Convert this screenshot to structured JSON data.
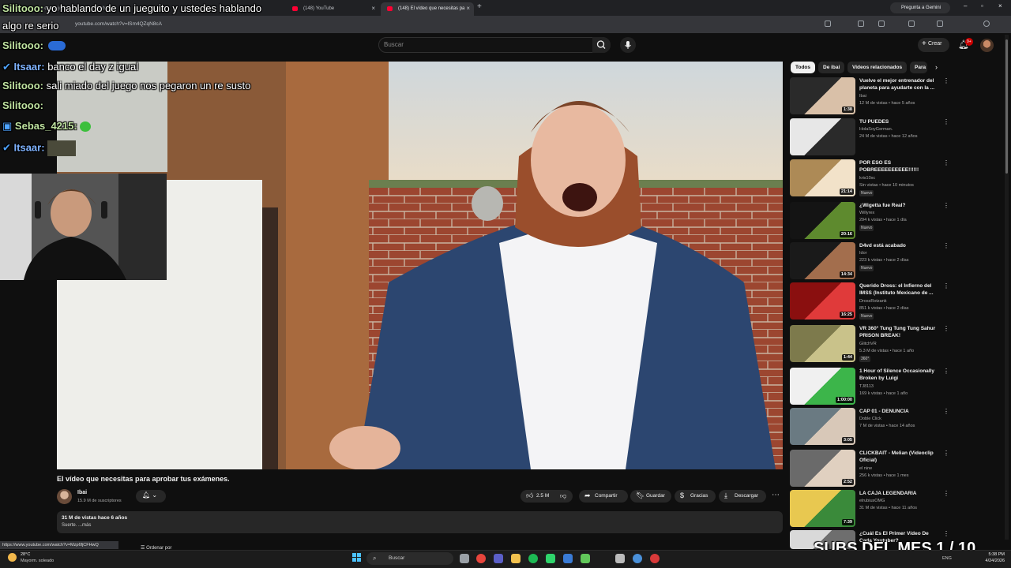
{
  "browser": {
    "tabs": [
      {
        "label": "yo hablando de un jueguito y ustedes hablando"
      },
      {
        "label": "(148) YouTube"
      },
      {
        "label": "(148) El vídeo que necesitas pa"
      }
    ],
    "url": "youtube.com/watch?v=lSm4QZqN8cA",
    "gemini_label": "Pregunta a Gemini",
    "status_url": "https://www.youtube.com/watch?v=Mzp6fjCFHwQ"
  },
  "youtube": {
    "search_placeholder": "Buscar",
    "create_label": "Crear",
    "notif_count": "9+",
    "video": {
      "title": "El vídeo que necesitas para aprobar tus exámenes.",
      "channel": "Ibai",
      "subscribers": "15.9 M de suscriptores",
      "likes": "2.5 M",
      "share": "Compartir",
      "save": "Guardar",
      "thanks": "Gracias",
      "download": "Descargar",
      "views_date": "31 M de vistas  hace 6 años",
      "desc_preview": "Suerte.  ...más",
      "sort_label": "Ordenar por"
    },
    "chips": [
      {
        "label": "Todos"
      },
      {
        "label": "De ibai"
      },
      {
        "label": "Videos relacionados"
      },
      {
        "label": "Para"
      }
    ],
    "recommendations": [
      {
        "title": "Vuelve el mejor entrenador del planeta para ayudarte con la ...",
        "channel": "Ibai",
        "meta": "12 M de vistas • hace 5 años",
        "duration": "1:38",
        "new": ""
      },
      {
        "title": "TU PUEDES",
        "channel": "HolaSoyGerman.",
        "meta": "24 M de vistas • hace 12 años",
        "duration": "",
        "new": ""
      },
      {
        "title": "POR ESO ES POBREEEEEEEEEE!!!!!!",
        "channel": "kris10xc",
        "meta": "Sin vistas • hace 10 minutos",
        "duration": "21:14",
        "new": "Nuevo"
      },
      {
        "title": "¿Wigetta fue Real?",
        "channel": "Willyrex",
        "meta": "294 k vistas • hace 1 día",
        "duration": "20:16",
        "new": "Nuevo"
      },
      {
        "title": "D4vd está acabado",
        "channel": "Idor",
        "meta": "223 k vistas • hace 2 días",
        "duration": "14:34",
        "new": "Nuevo"
      },
      {
        "title": "Querido Dross: el Infierno del IMSS (Instituto Mexicano de ...",
        "channel": "DrossRotzank",
        "meta": "851 k vistas • hace 2 días",
        "duration": "16:25",
        "new": "Nuevo"
      },
      {
        "title": "VR 360° Tung Tung Tung Sahur PRISON BREAK!",
        "channel": "GlitchVR",
        "meta": "5.3 M de vistas • hace 1 año",
        "duration": "1:44",
        "new": "360°"
      },
      {
        "title": "1 Hour of Silence Occasionally Broken by Luigi",
        "channel": "TJ8113",
        "meta": "169 k vistas • hace 1 año",
        "duration": "1:00:00",
        "new": ""
      },
      {
        "title": "CAP 01 - DENUNCIA",
        "channel": "Doble Click",
        "meta": "7 M de vistas • hace 14 años",
        "duration": "3:05",
        "new": ""
      },
      {
        "title": "CLICKBAIT - Melian (Videoclip Oficial)",
        "channel": "el nine",
        "meta": "256 k vistas • hace 1 mes",
        "duration": "2:52",
        "new": ""
      },
      {
        "title": "LA CAJA LEGENDARIA",
        "channel": "elrubiusOMG",
        "meta": "31 M de vistas • hace 11 años",
        "duration": "7:39",
        "new": ""
      },
      {
        "title": "¿Cuál Es El Primer Vídeo De Cada Youtuber?",
        "channel": "",
        "meta": "",
        "duration": "",
        "new": ""
      }
    ]
  },
  "stream": {
    "top_chat": "Silitooo: yo hablando de un jueguito y ustedes hablando algo re serio",
    "top_chat_user": "Silitooo:",
    "top_chat_l1": "yo hablando de un jueguito y ustedes hablando",
    "top_chat_l2": "algo re serio",
    "chat": [
      {
        "user": "Silitooo:",
        "text": ""
      },
      {
        "user": "Itsaar:",
        "text": "banco el day z igual"
      },
      {
        "user": "Silitooo:",
        "text": "sali miado del juego nos pegaron un re susto"
      },
      {
        "user": "Silitooo:",
        "text": ""
      },
      {
        "user": "Sebas_4215:",
        "text": ""
      },
      {
        "user": "Itsaar:",
        "text": ""
      }
    ],
    "subs_overlay": "SUBS DEL MES 1 / 10"
  },
  "taskbar": {
    "temp": "28°C",
    "weather": "Mayorm. soleado",
    "search": "Buscar",
    "lang": "ENG",
    "time": "5:38 PM",
    "date": "4/24/2026"
  },
  "colors": {
    "accent": "#ff0033",
    "bg": "#0f0f0f"
  }
}
